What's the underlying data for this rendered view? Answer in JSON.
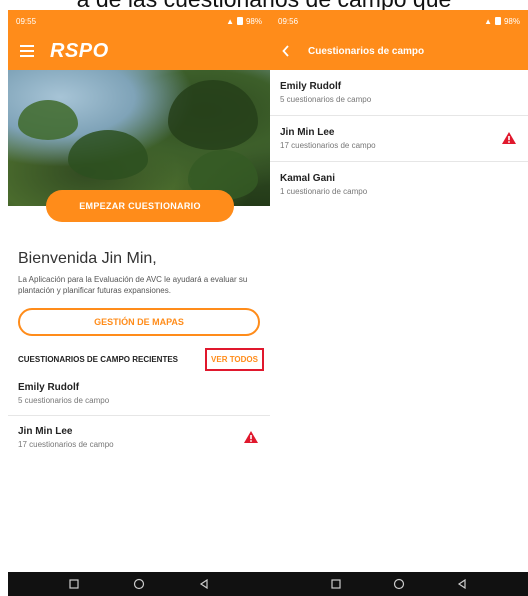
{
  "caption": "a de las cuestionarios de campo que",
  "colors": {
    "brand": "#ff8c1a",
    "highlight": "#e0182d",
    "warning": "#e0182d"
  },
  "left": {
    "status": {
      "time": "09:55",
      "battery": "98%"
    },
    "appbar": {
      "brand": "RSPO",
      "menu_icon": "menu-icon"
    },
    "start_button": "EMPEZAR CUESTIONARIO",
    "welcome": "Bienvenida Jin Min,",
    "intro": "La Aplicación para la Evaluación de AVC le ayudará a evaluar su plantación y planificar futuras expansiones.",
    "maps_button": "GESTIÓN DE MAPAS",
    "recent_title": "CUESTIONARIOS DE CAMPO RECIENTES",
    "see_all": "VER TODOS",
    "items": [
      {
        "name": "Emily Rudolf",
        "sub": "5 cuestionarios de campo",
        "warning": false
      },
      {
        "name": "Jin Min Lee",
        "sub": "17 cuestionarios de campo",
        "warning": true
      }
    ]
  },
  "right": {
    "status": {
      "time": "09:56",
      "battery": "98%"
    },
    "title": "Cuestionarios de campo",
    "items": [
      {
        "name": "Emily Rudolf",
        "sub": "5 cuestionarios de campo",
        "warning": false
      },
      {
        "name": "Jin Min Lee",
        "sub": "17 cuestionarios de campo",
        "warning": true
      },
      {
        "name": "Kamal Gani",
        "sub": "1 cuestionario de campo",
        "warning": false
      }
    ]
  }
}
